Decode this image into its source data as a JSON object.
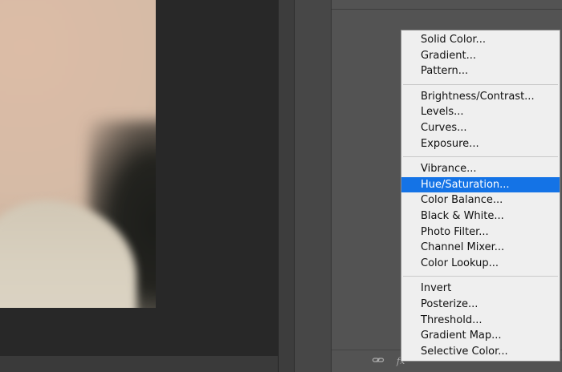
{
  "menu": {
    "groups": [
      {
        "items": [
          {
            "label": "Solid Color..."
          },
          {
            "label": "Gradient..."
          },
          {
            "label": "Pattern..."
          }
        ]
      },
      {
        "items": [
          {
            "label": "Brightness/Contrast..."
          },
          {
            "label": "Levels..."
          },
          {
            "label": "Curves..."
          },
          {
            "label": "Exposure..."
          }
        ]
      },
      {
        "items": [
          {
            "label": "Vibrance..."
          },
          {
            "label": "Hue/Saturation..."
          },
          {
            "label": "Color Balance..."
          },
          {
            "label": "Black & White..."
          },
          {
            "label": "Photo Filter..."
          },
          {
            "label": "Channel Mixer..."
          },
          {
            "label": "Color Lookup..."
          }
        ]
      },
      {
        "items": [
          {
            "label": "Invert"
          },
          {
            "label": "Posterize..."
          },
          {
            "label": "Threshold..."
          },
          {
            "label": "Gradient Map..."
          },
          {
            "label": "Selective Color..."
          }
        ]
      }
    ],
    "selected": "Hue/Saturation...",
    "highlight_color": "#1473e6"
  },
  "layers_footer": {
    "icons": [
      "link-icon",
      "fx-icon",
      "mask-icon",
      "adjustment-layer-icon",
      "group-icon",
      "new-layer-icon",
      "trash-icon"
    ]
  }
}
